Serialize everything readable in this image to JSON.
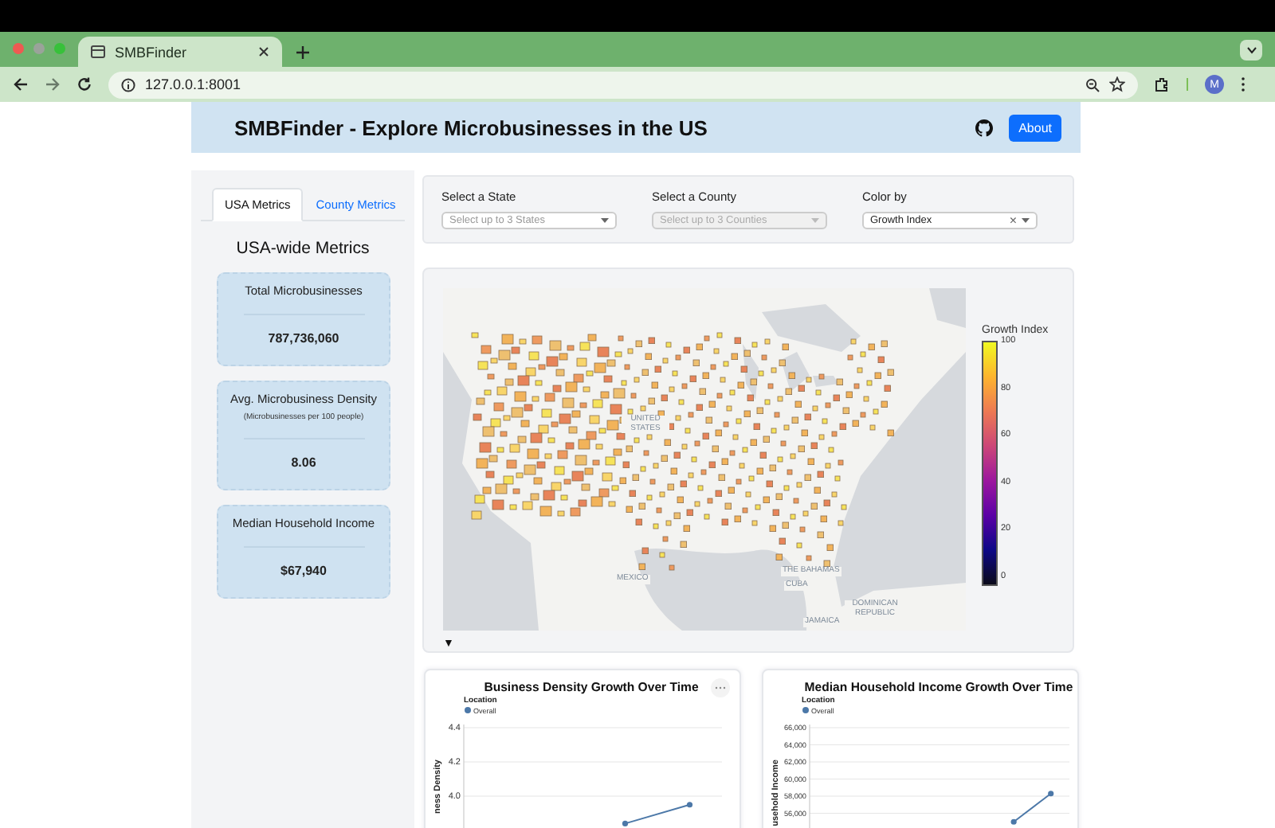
{
  "browser": {
    "tab_title": "SMBFinder",
    "url": "127.0.0.1:8001",
    "avatar": "M"
  },
  "header": {
    "title": "SMBFinder - Explore Microbusinesses in the US",
    "about_button": "About"
  },
  "sidebar": {
    "tabs": [
      {
        "label": "USA Metrics",
        "selected": true
      },
      {
        "label": "County Metrics",
        "selected": false
      }
    ],
    "heading": "USA-wide Metrics",
    "cards": [
      {
        "title": "Total Microbusinesses",
        "value": "787,736,060"
      },
      {
        "title": "Avg. Microbusiness Density",
        "subtitle": "(Microbusinesses per 100 people)",
        "value": "8.06"
      },
      {
        "title": "Median Household Income",
        "value": "$67,940"
      }
    ]
  },
  "filters": [
    {
      "label": "Select a State",
      "placeholder": "Select up to 3 States",
      "disabled": false
    },
    {
      "label": "Select a County",
      "placeholder": "Select up to 3 Counties",
      "disabled": true
    },
    {
      "label": "Color by",
      "value": "Growth Index",
      "clear": "×",
      "disabled": false
    }
  ],
  "map": {
    "labels": [
      "UNITED STATES",
      "MEXICO",
      "THE BAHAMAS",
      "CUBA",
      "DOMINICAN REPUBLIC",
      "JAMAICA"
    ],
    "colorbar": {
      "title": "Growth Index",
      "ticks": [
        "100",
        "80",
        "60",
        "40",
        "20",
        "0"
      ]
    },
    "toggle": "▼"
  },
  "charts": [
    {
      "legend_title": "Location",
      "chart_data": {
        "type": "line",
        "title": "Business Density Growth Over Time",
        "ylabel": "ness Density",
        "grid": true,
        "ylim": [
          3.8,
          4.4
        ],
        "yticks": [
          {
            "value": 4.4,
            "label": "4.4"
          },
          {
            "value": 4.2,
            "label": "4.2"
          },
          {
            "value": 4,
            "label": "4.0"
          }
        ],
        "series": [
          {
            "name": "Overall",
            "color": "#4c78a8",
            "marker": "circle",
            "values": [
              null,
              null,
              3.84,
              3.95
            ]
          }
        ]
      }
    },
    {
      "legend_title": "Location",
      "chart_data": {
        "type": "line",
        "title": "Median Household Income Growth Over Time",
        "ylabel": "usehold Income",
        "grid": true,
        "ylim": [
          54000,
          66000
        ],
        "yticks": [
          {
            "value": 66000,
            "label": "66,000"
          },
          {
            "value": 64000,
            "label": "64,000"
          },
          {
            "value": 62000,
            "label": "62,000"
          },
          {
            "value": 60000,
            "label": "60,000"
          },
          {
            "value": 58000,
            "label": "58,000"
          },
          {
            "value": 56000,
            "label": "56,000"
          }
        ],
        "series": [
          {
            "name": "Overall",
            "color": "#4c78a8",
            "marker": "circle",
            "values": [
              null,
              null,
              null,
              null,
              null,
              55000,
              58300
            ]
          }
        ]
      }
    }
  ]
}
